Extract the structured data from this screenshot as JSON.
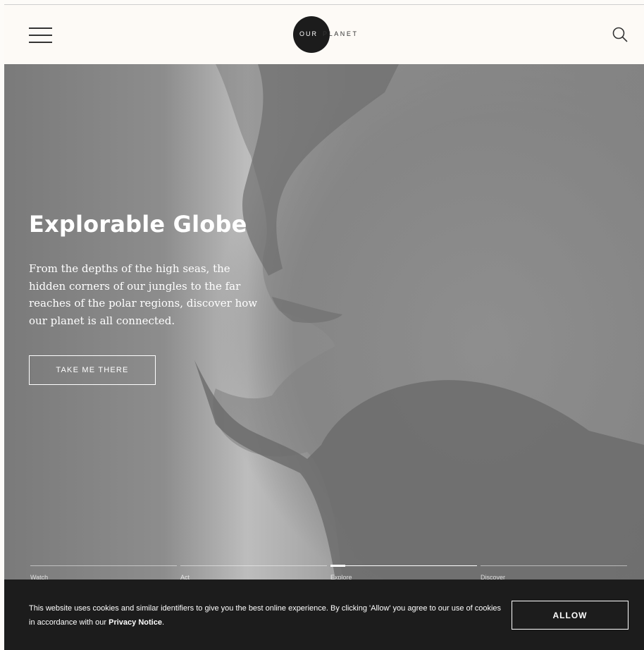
{
  "header": {
    "logo_our": "OUR",
    "logo_planet": "PLANET",
    "menu_icon": "hamburger-menu-icon",
    "search_icon": "search-icon"
  },
  "hero": {
    "title": "Explorable Globe",
    "description": "From the depths of the high seas, the hidden corners of our jungles to the far reaches of the polar regions, discover how our planet is all connected.",
    "cta_label": "TAKE ME THERE"
  },
  "tabs": [
    {
      "label": "Watch",
      "progress": 0
    },
    {
      "label": "Act",
      "progress": 0
    },
    {
      "label": "Explore",
      "progress": 0.1
    },
    {
      "label": "Discover",
      "progress": 0
    }
  ],
  "cookie": {
    "text_before": "This website uses cookies and similar identifiers to give you the best online experience. By clicking 'Allow' you agree to our use of cookies in accordance with our ",
    "link_text": "Privacy Notice",
    "text_after": ".",
    "allow_label": "ALLOW"
  },
  "colors": {
    "header_bg": "#fdfaf6",
    "cookie_bg": "#1c1c1c",
    "logo_circle": "#1c1c1c"
  }
}
